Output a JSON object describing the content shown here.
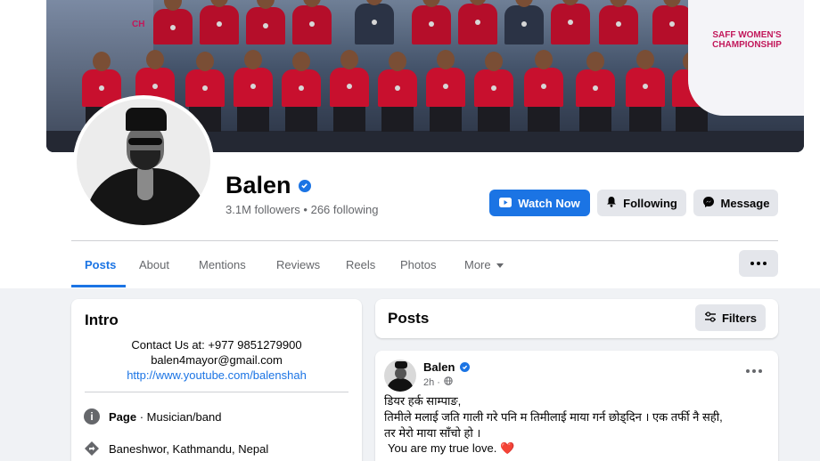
{
  "cover": {
    "banner_text": "SAFF WOMEN'S CHAMPIONSHIP",
    "banner_left_text": "CH"
  },
  "profile": {
    "name": "Balen",
    "stats": "3.1M followers • 266 following"
  },
  "actions": {
    "watch_label": "Watch Now",
    "following_label": "Following",
    "message_label": "Message"
  },
  "tabs": [
    {
      "label": "Posts",
      "active": true
    },
    {
      "label": "About"
    },
    {
      "label": "Mentions"
    },
    {
      "label": "Reviews"
    },
    {
      "label": "Reels"
    },
    {
      "label": "Photos"
    },
    {
      "label": "More"
    }
  ],
  "intro": {
    "title": "Intro",
    "contact": "Contact Us at: +977 9851279900",
    "email": "balen4mayor@gmail.com",
    "link": "http://www.youtube.com/balenshah",
    "page_label": "Page",
    "page_category": " · Musician/band",
    "location": "Baneshwor, Kathmandu, Nepal"
  },
  "posts_section": {
    "title": "Posts",
    "filters_label": "Filters"
  },
  "post": {
    "author": "Balen",
    "time": "2h ·",
    "line1": "डियर हर्क साम्पाङ,",
    "line2": "तिमीले मलाई जति गाली गरे पनि म तिमीलाई माया गर्न छोड्दिन । एक तर्फी नै सही,",
    "line3": "तर मेरो माया साँचो हो ।",
    "line4": "You are my true love.",
    "line4_emoji": "❤️"
  },
  "colors": {
    "accent": "#1b74e4",
    "background": "#f0f2f5",
    "secondary_button": "#e4e6eb"
  },
  "icons": [
    "verified-badge-icon",
    "play-icon",
    "bell-icon",
    "messenger-icon",
    "more-dots-icon",
    "filters-icon",
    "info-icon",
    "location-pin-icon",
    "globe-icon"
  ]
}
